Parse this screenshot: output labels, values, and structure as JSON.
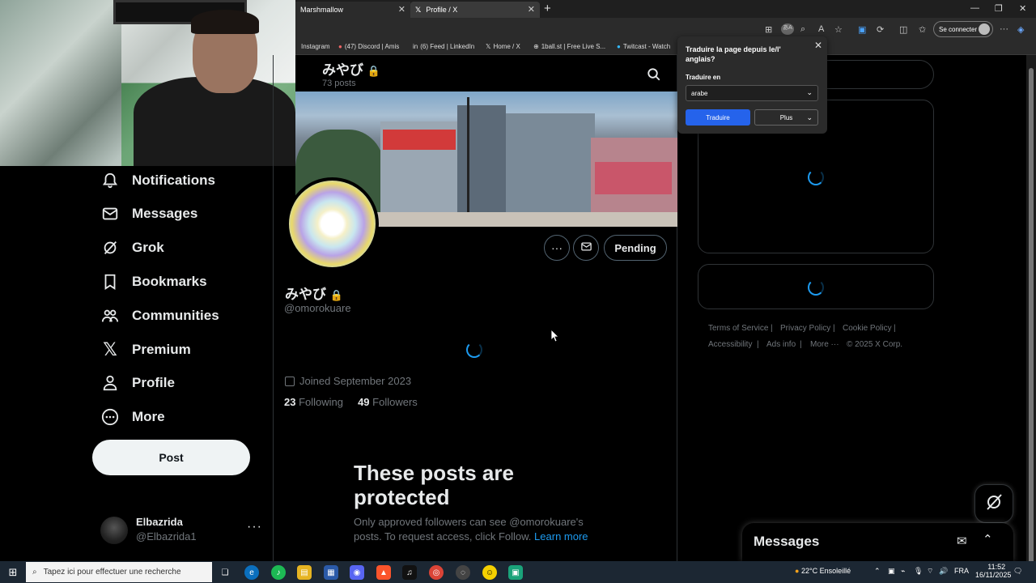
{
  "browser": {
    "tabs": [
      {
        "label": "Marshmallow"
      },
      {
        "label": "Profile / X"
      }
    ],
    "signin_label": "Se connecter",
    "bookmarks": [
      {
        "label": "Instagram"
      },
      {
        "label": "(47) Discord | Amis"
      },
      {
        "label": "(6) Feed | LinkedIn"
      },
      {
        "label": "Home / X"
      },
      {
        "label": "1ball.st | Free Live S..."
      },
      {
        "label": "Twitcast - Watch"
      }
    ]
  },
  "translate_popup": {
    "title": "Traduire la page depuis le/l' anglais?",
    "label": "Traduire en",
    "selected_language": "arabe",
    "translate_button": "Traduire",
    "more_button": "Plus"
  },
  "nav": {
    "items": [
      {
        "label": "Notifications",
        "icon": "bell-icon"
      },
      {
        "label": "Messages",
        "icon": "envelope-icon"
      },
      {
        "label": "Grok",
        "icon": "grok-icon"
      },
      {
        "label": "Bookmarks",
        "icon": "bookmark-icon"
      },
      {
        "label": "Communities",
        "icon": "communities-icon"
      },
      {
        "label": "Premium",
        "icon": "x-logo-icon"
      },
      {
        "label": "Profile",
        "icon": "person-icon"
      },
      {
        "label": "More",
        "icon": "more-circle-icon"
      }
    ],
    "post_button": "Post",
    "account": {
      "name": "Elbazrida",
      "handle": "@Elbazrida1"
    }
  },
  "profile": {
    "header_name": "みやび",
    "post_count": "73 posts",
    "display_name": "みやび",
    "handle": "@omorokuare",
    "joined": "Joined September 2023",
    "following_count": "23",
    "following_label": "Following",
    "followers_count": "49",
    "followers_label": "Followers",
    "pending_button": "Pending",
    "protected_title": "These posts are protected",
    "protected_desc": "Only approved followers can see @omorokuare's posts. To request access, click Follow.",
    "learn_more": "Learn more"
  },
  "footer": {
    "links": [
      "Terms of Service",
      "Privacy Policy",
      "Cookie Policy",
      "Accessibility",
      "Ads info",
      "More ···",
      "© 2025 X Corp."
    ]
  },
  "messages_drawer": {
    "title": "Messages"
  },
  "taskbar": {
    "search_placeholder": "Tapez ici pour effectuer une recherche",
    "weather": "22°C  Ensoleillé",
    "lang": "FRA",
    "time": "11:52",
    "date": "16/11/2025"
  },
  "colors": {
    "accent": "#1d9bf0",
    "background": "#000000",
    "muted": "#71767b",
    "translate_button": "#2563eb"
  }
}
